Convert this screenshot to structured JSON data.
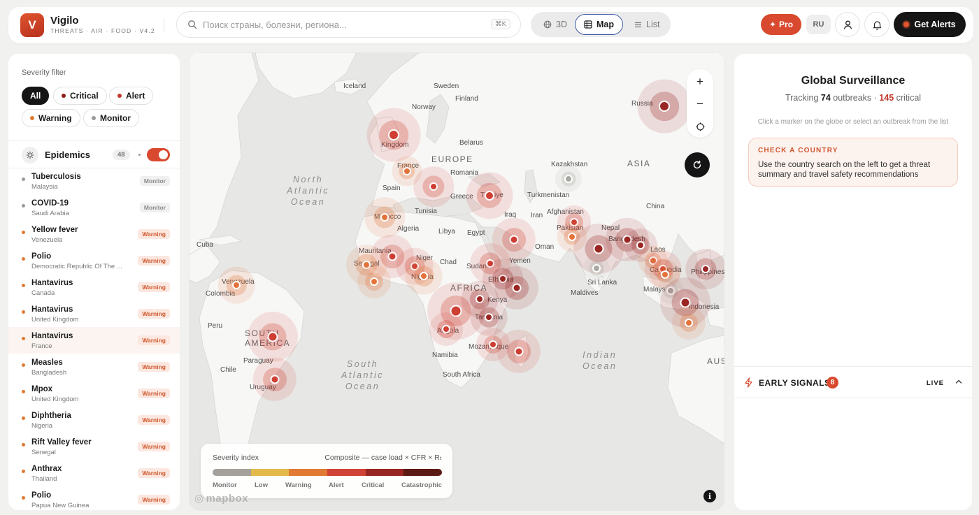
{
  "brand": {
    "logo_letter": "V",
    "name": "Vigilo",
    "subtitle": "THREATS · AIR · FOOD · V4.2"
  },
  "search": {
    "placeholder": "Поиск страны, болезни, региона...",
    "shortcut": "⌘K"
  },
  "views": [
    {
      "label": "3D",
      "icon": "globe-icon",
      "active": false
    },
    {
      "label": "Map",
      "icon": "map-grid-icon",
      "active": true
    },
    {
      "label": "List",
      "icon": "list-icon",
      "active": false
    }
  ],
  "header_actions": {
    "pro_label": "Pro",
    "lang_label": "RU",
    "get_alerts_label": "Get Alerts"
  },
  "severity_filter": {
    "title": "Severity filter",
    "chips": [
      {
        "label": "All",
        "active": true,
        "color": ""
      },
      {
        "label": "Critical",
        "active": false,
        "color": "#8e1f1c"
      },
      {
        "label": "Alert",
        "active": false,
        "color": "#c0392b"
      },
      {
        "label": "Warning",
        "active": false,
        "color": "#e07a34"
      },
      {
        "label": "Monitor",
        "active": false,
        "color": "#9a9a9a"
      }
    ]
  },
  "epidemics": {
    "title": "Epidemics",
    "count": "48",
    "toggle_on": true,
    "items": [
      {
        "name": "Tuberculosis",
        "country": "Malaysia",
        "severity": "Monitor",
        "color": "#9a9a9a",
        "selected": false
      },
      {
        "name": "COVID-19",
        "country": "Saudi Arabia",
        "severity": "Monitor",
        "color": "#9a9a9a",
        "selected": false
      },
      {
        "name": "Yellow fever",
        "country": "Venezuela",
        "severity": "Warning",
        "color": "#e07a34",
        "selected": false
      },
      {
        "name": "Polio",
        "country": "Democratic Republic Of The ...",
        "severity": "Warning",
        "color": "#e07a34",
        "selected": false
      },
      {
        "name": "Hantavirus",
        "country": "Canada",
        "severity": "Warning",
        "color": "#e07a34",
        "selected": false
      },
      {
        "name": "Hantavirus",
        "country": "United Kingdom",
        "severity": "Warning",
        "color": "#e07a34",
        "selected": false
      },
      {
        "name": "Hantavirus",
        "country": "France",
        "severity": "Warning",
        "color": "#e07a34",
        "selected": true
      },
      {
        "name": "Measles",
        "country": "Bangladesh",
        "severity": "Warning",
        "color": "#e07a34",
        "selected": false
      },
      {
        "name": "Mpox",
        "country": "United Kingdom",
        "severity": "Warning",
        "color": "#e07a34",
        "selected": false
      },
      {
        "name": "Diphtheria",
        "country": "Nigeria",
        "severity": "Warning",
        "color": "#e07a34",
        "selected": false
      },
      {
        "name": "Rift Valley fever",
        "country": "Senegal",
        "severity": "Warning",
        "color": "#e07a34",
        "selected": false
      },
      {
        "name": "Anthrax",
        "country": "Thailand",
        "severity": "Warning",
        "color": "#e07a34",
        "selected": false
      },
      {
        "name": "Polio",
        "country": "Papua New Guinea",
        "severity": "Warning",
        "color": "#e07a34",
        "selected": false
      }
    ]
  },
  "map": {
    "labels": {
      "iceland": "Iceland",
      "sweden": "Sweden",
      "norway": "Norway",
      "finland": "Finland",
      "russia": "Russia",
      "kingdom": "Kingdom",
      "france": "France",
      "europe": "EUROPE",
      "belarus": "Belarus",
      "romania": "Romania",
      "kazakhstan": "Kazakhstan",
      "asia": "ASIA",
      "spain": "Spain",
      "greece": "Greece",
      "turkiye": "Türkiye",
      "turkmenistan": "Turkmenistan",
      "china": "China",
      "afghanistan": "Afghanistan",
      "iraq": "Iraq",
      "iran": "Iran",
      "tunisia": "Tunisia",
      "morocco": "Morocco",
      "algeria": "Algeria",
      "libya": "Libya",
      "egypt": "Egypt",
      "pakistan": "Pakistan",
      "nepal": "Nepal",
      "bangladesh": "Bangladesh",
      "oman": "Oman",
      "cuba": "Cuba",
      "mauritania": "Mauritania",
      "niger": "Niger",
      "chad": "Chad",
      "sudan": "Sudan",
      "yemen": "Yemen",
      "laos": "Laos",
      "senegal": "Senegal",
      "nigeria": "Nigeria",
      "ethiopia": "Ethiopia",
      "cambodia": "Cambodia",
      "philippines": "Philippines",
      "venezuela": "Venezuela",
      "africa": "AFRICA",
      "sri_lanka": "Sri Lanka",
      "malaysia": "Malays",
      "colombia": "Colombia",
      "kenya": "Kenya",
      "maldives": "Maldives",
      "indonesia": "Indonesia",
      "angola": "Angola",
      "tanzania": "Tanzania",
      "peru": "Peru",
      "south_america": "SOUTH AMERICA",
      "mozambique": "Mozambique",
      "paraguay": "Paraguay",
      "namibia": "Namibia",
      "chile": "Chile",
      "south_africa": "South Africa",
      "uruguay": "Uruguay",
      "aus": "AUS",
      "north_atlantic": "North\nAtlantic\nOcean",
      "south_atlantic": "South\nAtlantic\nOcean",
      "indian_ocean": "Indian\nOcean"
    },
    "zoom_in": "+",
    "zoom_out": "−",
    "attribution": "mapbox"
  },
  "legend": {
    "title": "Severity index",
    "formula": "Composite — case load × CFR × Rₜ",
    "levels": [
      {
        "label": "Monitor",
        "color": "#a3a19a"
      },
      {
        "label": "Low",
        "color": "#e2b94a"
      },
      {
        "label": "Warning",
        "color": "#e07a34"
      },
      {
        "label": "Alert",
        "color": "#cf4336"
      },
      {
        "label": "Critical",
        "color": "#9a2623"
      },
      {
        "label": "Catastrophic",
        "color": "#5c1a14"
      }
    ]
  },
  "surveillance": {
    "title": "Global Surveillance",
    "tracking_prefix": "Tracking",
    "outbreaks": "74",
    "outbreaks_suffix": "outbreaks ·",
    "critical": "145",
    "critical_suffix": "critical",
    "hint": "Click a marker on the globe or select an outbreak from the list",
    "check_title": "CHECK A COUNTRY",
    "check_desc": "Use the country search on the left to get a threat summary and travel safety recommendations"
  },
  "signals": {
    "title": "EARLY SIGNALS",
    "count": "8",
    "live": "LIVE"
  }
}
